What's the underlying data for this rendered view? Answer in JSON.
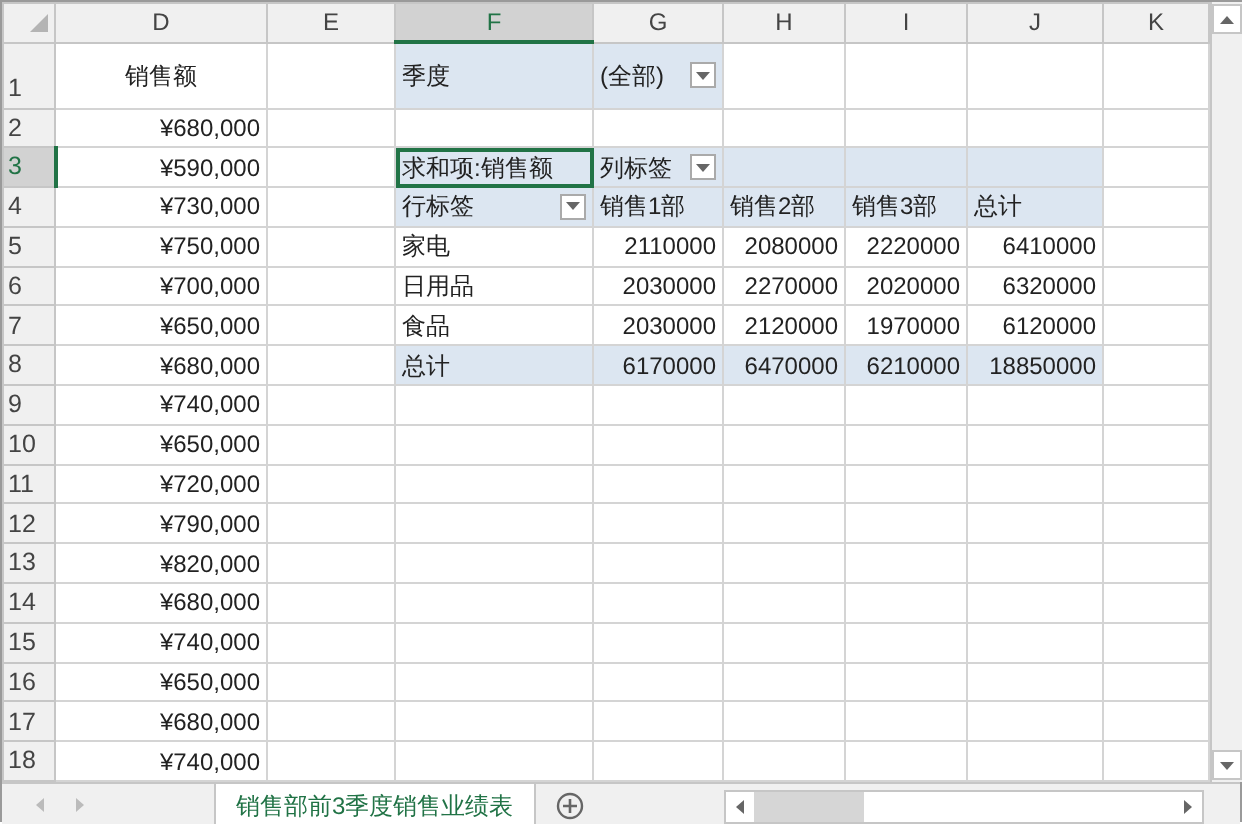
{
  "columns": [
    {
      "label": "D",
      "selected": false
    },
    {
      "label": "E",
      "selected": false
    },
    {
      "label": "F",
      "selected": true
    },
    {
      "label": "G",
      "selected": false
    },
    {
      "label": "H",
      "selected": false
    },
    {
      "label": "I",
      "selected": false
    },
    {
      "label": "J",
      "selected": false
    },
    {
      "label": "K",
      "selected": false
    }
  ],
  "rows": [
    {
      "label": "1",
      "selected": false,
      "cells": [
        {
          "kind": "title",
          "text": "销售额",
          "selected": false
        },
        {
          "kind": "blank",
          "selected": false
        },
        {
          "kind": "filter",
          "text": "季度",
          "selected": false
        },
        {
          "kind": "filter",
          "text": "(全部)",
          "dropdown": true,
          "selected": false
        },
        {
          "kind": "blank",
          "selected": false
        },
        {
          "kind": "blank",
          "selected": false
        },
        {
          "kind": "blank",
          "selected": false
        },
        {
          "kind": "blank",
          "selected": false
        }
      ]
    },
    {
      "label": "2",
      "selected": false,
      "cells": [
        {
          "kind": "currency",
          "text": "¥680,000",
          "selected": false
        },
        {
          "kind": "blank",
          "selected": false
        },
        {
          "kind": "blank",
          "selected": false
        },
        {
          "kind": "blank",
          "selected": false
        },
        {
          "kind": "blank",
          "selected": false
        },
        {
          "kind": "blank",
          "selected": false
        },
        {
          "kind": "blank",
          "selected": false
        },
        {
          "kind": "blank",
          "selected": false
        }
      ]
    },
    {
      "label": "3",
      "selected": true,
      "cells": [
        {
          "kind": "currency",
          "text": "¥590,000",
          "selected": false
        },
        {
          "kind": "blank",
          "selected": false
        },
        {
          "kind": "pivot-head",
          "text": "求和项:销售额",
          "selected": true
        },
        {
          "kind": "pivot-head",
          "text": "列标签",
          "dropdown": true,
          "selected": false
        },
        {
          "kind": "pivot-head",
          "selected": false
        },
        {
          "kind": "pivot-head",
          "selected": false
        },
        {
          "kind": "pivot-head",
          "selected": false
        },
        {
          "kind": "blank",
          "selected": false
        }
      ]
    },
    {
      "label": "4",
      "selected": false,
      "cells": [
        {
          "kind": "currency",
          "text": "¥730,000",
          "selected": false
        },
        {
          "kind": "blank",
          "selected": false
        },
        {
          "kind": "pivot-head",
          "text": "行标签",
          "dropdown": true,
          "selected": false
        },
        {
          "kind": "pivot-head",
          "text": "销售1部",
          "selected": false
        },
        {
          "kind": "pivot-head",
          "text": "销售2部",
          "selected": false
        },
        {
          "kind": "pivot-head",
          "text": "销售3部",
          "selected": false
        },
        {
          "kind": "pivot-head",
          "text": "总计",
          "selected": false
        },
        {
          "kind": "blank",
          "selected": false
        }
      ]
    },
    {
      "label": "5",
      "selected": false,
      "cells": [
        {
          "kind": "currency",
          "text": "¥750,000",
          "selected": false
        },
        {
          "kind": "blank",
          "selected": false
        },
        {
          "kind": "pivot-item",
          "text": "家电",
          "selected": false
        },
        {
          "kind": "pivot-number",
          "text": "2110000",
          "selected": false
        },
        {
          "kind": "pivot-number",
          "text": "2080000",
          "selected": false
        },
        {
          "kind": "pivot-number",
          "text": "2220000",
          "selected": false
        },
        {
          "kind": "pivot-number",
          "text": "6410000",
          "selected": false
        },
        {
          "kind": "blank",
          "selected": false
        }
      ]
    },
    {
      "label": "6",
      "selected": false,
      "cells": [
        {
          "kind": "currency",
          "text": "¥700,000",
          "selected": false
        },
        {
          "kind": "blank",
          "selected": false
        },
        {
          "kind": "pivot-item",
          "text": "日用品",
          "selected": false
        },
        {
          "kind": "pivot-number",
          "text": "2030000",
          "selected": false
        },
        {
          "kind": "pivot-number",
          "text": "2270000",
          "selected": false
        },
        {
          "kind": "pivot-number",
          "text": "2020000",
          "selected": false
        },
        {
          "kind": "pivot-number",
          "text": "6320000",
          "selected": false
        },
        {
          "kind": "blank",
          "selected": false
        }
      ]
    },
    {
      "label": "7",
      "selected": false,
      "cells": [
        {
          "kind": "currency",
          "text": "¥650,000",
          "selected": false
        },
        {
          "kind": "blank",
          "selected": false
        },
        {
          "kind": "pivot-item",
          "text": "食品",
          "selected": false
        },
        {
          "kind": "pivot-number",
          "text": "2030000",
          "selected": false
        },
        {
          "kind": "pivot-number",
          "text": "2120000",
          "selected": false
        },
        {
          "kind": "pivot-number",
          "text": "1970000",
          "selected": false
        },
        {
          "kind": "pivot-number",
          "text": "6120000",
          "selected": false
        },
        {
          "kind": "blank",
          "selected": false
        }
      ]
    },
    {
      "label": "8",
      "selected": false,
      "cells": [
        {
          "kind": "currency",
          "text": "¥680,000",
          "selected": false
        },
        {
          "kind": "blank",
          "selected": false
        },
        {
          "kind": "pivot-total-label",
          "text": "总计",
          "selected": false
        },
        {
          "kind": "pivot-total",
          "text": "6170000",
          "selected": false
        },
        {
          "kind": "pivot-total",
          "text": "6470000",
          "selected": false
        },
        {
          "kind": "pivot-total",
          "text": "6210000",
          "selected": false
        },
        {
          "kind": "pivot-total",
          "text": "18850000",
          "selected": false
        },
        {
          "kind": "blank",
          "selected": false
        }
      ]
    },
    {
      "label": "9",
      "selected": false,
      "cells": [
        {
          "kind": "currency",
          "text": "¥740,000",
          "selected": false
        }
      ]
    },
    {
      "label": "10",
      "selected": false,
      "cells": [
        {
          "kind": "currency",
          "text": "¥650,000",
          "selected": false
        }
      ]
    },
    {
      "label": "11",
      "selected": false,
      "cells": [
        {
          "kind": "currency",
          "text": "¥720,000",
          "selected": false
        }
      ]
    },
    {
      "label": "12",
      "selected": false,
      "cells": [
        {
          "kind": "currency",
          "text": "¥790,000",
          "selected": false
        }
      ]
    },
    {
      "label": "13",
      "selected": false,
      "cells": [
        {
          "kind": "currency",
          "text": "¥820,000",
          "selected": false
        }
      ]
    },
    {
      "label": "14",
      "selected": false,
      "cells": [
        {
          "kind": "currency",
          "text": "¥680,000",
          "selected": false
        }
      ]
    },
    {
      "label": "15",
      "selected": false,
      "cells": [
        {
          "kind": "currency",
          "text": "¥740,000",
          "selected": false
        }
      ]
    },
    {
      "label": "16",
      "selected": false,
      "cells": [
        {
          "kind": "currency",
          "text": "¥650,000",
          "selected": false
        }
      ]
    },
    {
      "label": "17",
      "selected": false,
      "cells": [
        {
          "kind": "currency",
          "text": "¥680,000",
          "selected": false
        }
      ]
    },
    {
      "label": "18",
      "selected": false,
      "cells": [
        {
          "kind": "currency",
          "text": "¥740,000",
          "selected": false
        }
      ]
    }
  ],
  "sheet_tabs": [
    {
      "label": "销售部前3季度销售业绩表",
      "selected": true
    }
  ]
}
